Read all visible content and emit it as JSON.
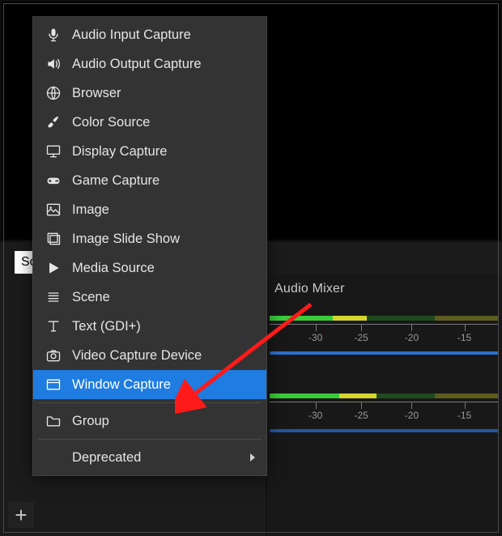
{
  "preview_alt": "preview area",
  "panel_tab_label": "So",
  "audio_mixer_title": "Audio Mixer",
  "meter_ticks": [
    "-30",
    "-25",
    "-20",
    "-15"
  ],
  "plus_glyph": "+",
  "menu": {
    "items": [
      {
        "label": "Audio Input Capture",
        "icon": "mic-icon"
      },
      {
        "label": "Audio Output Capture",
        "icon": "speaker-icon"
      },
      {
        "label": "Browser",
        "icon": "globe-icon"
      },
      {
        "label": "Color Source",
        "icon": "brush-icon"
      },
      {
        "label": "Display Capture",
        "icon": "monitor-icon"
      },
      {
        "label": "Game Capture",
        "icon": "gamepad-icon"
      },
      {
        "label": "Image",
        "icon": "image-icon"
      },
      {
        "label": "Image Slide Show",
        "icon": "slideshow-icon"
      },
      {
        "label": "Media Source",
        "icon": "play-icon"
      },
      {
        "label": "Scene",
        "icon": "list-icon"
      },
      {
        "label": "Text (GDI+)",
        "icon": "text-icon"
      },
      {
        "label": "Video Capture Device",
        "icon": "camera-icon"
      },
      {
        "label": "Window Capture",
        "icon": "window-icon"
      }
    ],
    "group": {
      "label": "Group",
      "icon": "folder-icon"
    },
    "submenu": {
      "label": "Deprecated"
    },
    "selected_index": 12
  },
  "annotation": {
    "type": "arrow",
    "color": "#ff1a1a"
  }
}
